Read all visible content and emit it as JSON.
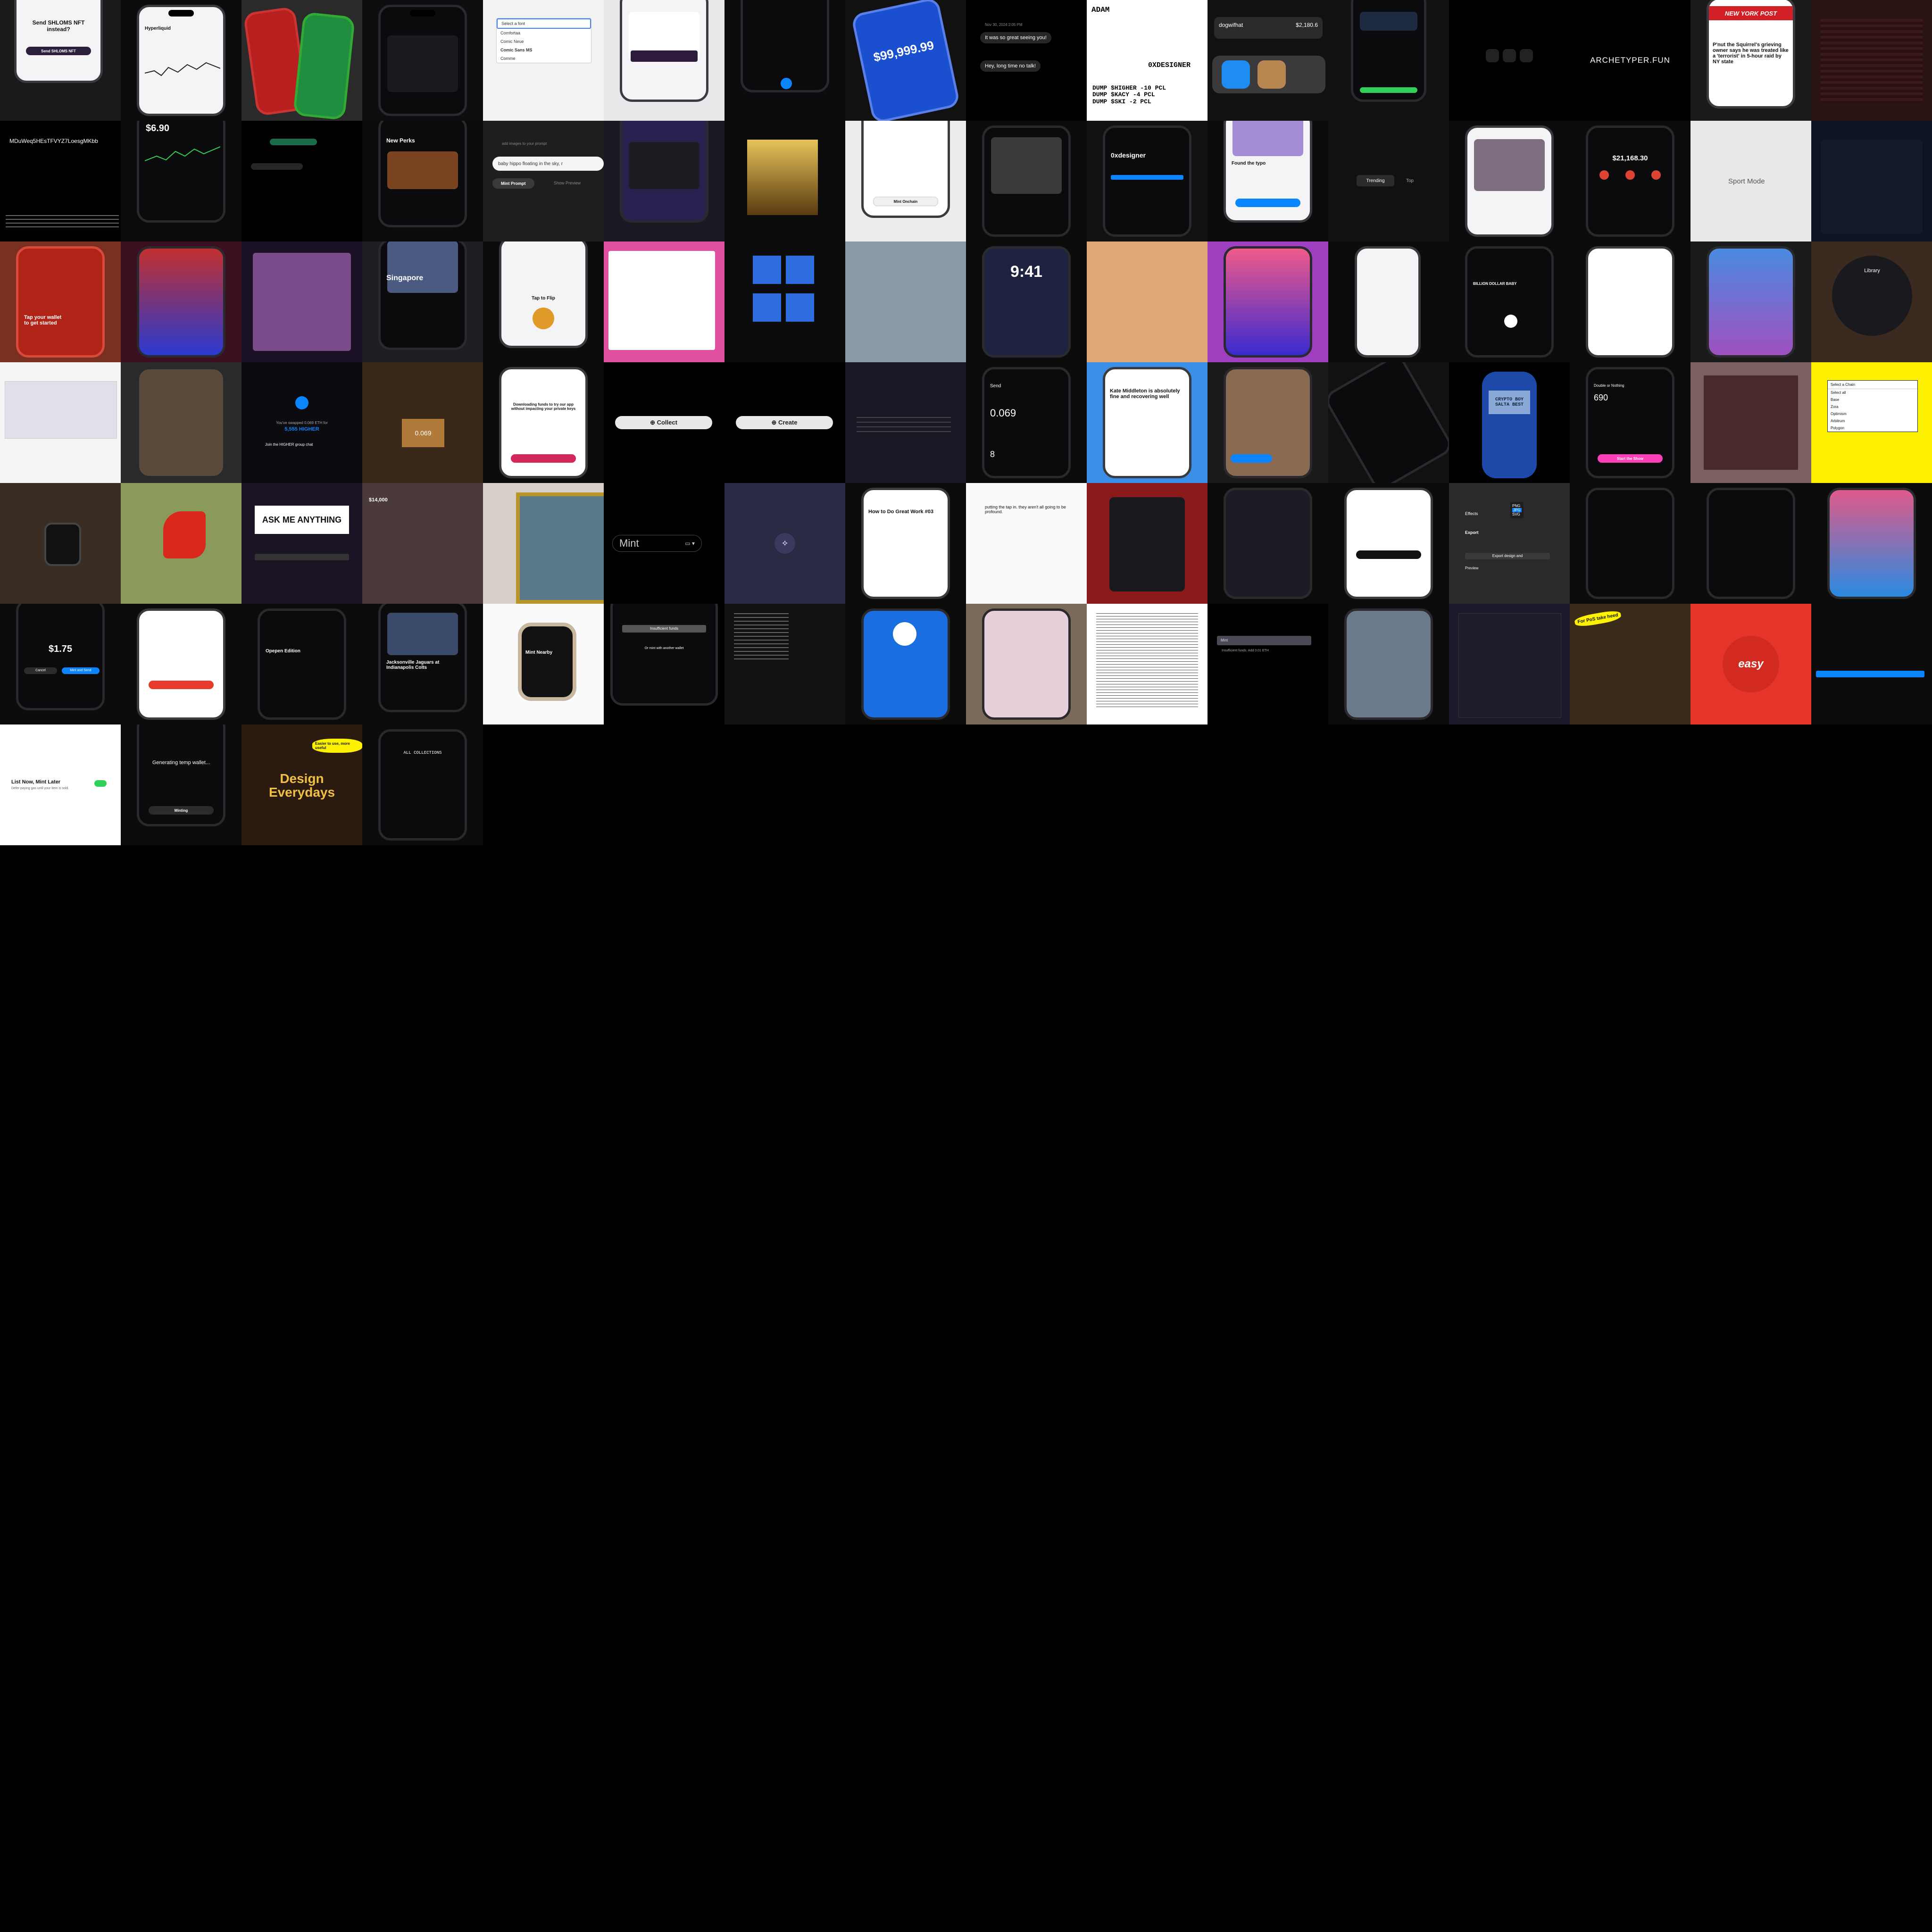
{
  "tiles": {
    "r0": {
      "send": {
        "title": "Send SHLOMS NFT instead?",
        "button": "Send SHLOMS NFT"
      },
      "hyperliquid": {
        "title": "Hyperliquid"
      },
      "font_menu": {
        "items": [
          "Select a font",
          "Comfortaa",
          "Comic Neue",
          "Comic Sans MS",
          "Comme"
        ]
      },
      "bitcoin_price": {
        "price": "$99,999.99"
      },
      "chat": {
        "date": "Nov 30, 2024 2:05 PM",
        "msg1": "It was so great seeing you!",
        "msg2": "Hey, long time no talk!"
      },
      "oxdesigner": {
        "name": "ADAM",
        "handle": "0XDESIGNER",
        "rows": [
          "DUMP $HIGHER -10 PCL",
          "DUMP $KACY -4 PCL",
          "DUMP $SKI -2 PCL"
        ]
      },
      "dogwifhat": {
        "label": "dogwifhat",
        "price": "$2,180.6"
      },
      "archetyper": {
        "label": "ARCHETYPER.FUN"
      },
      "nypost": {
        "brand": "NEW YORK POST",
        "headline": "P'nut the Squirrel's grieving owner says he was treated like a 'terrorist' in 5-hour raid by NY state"
      }
    },
    "r1": {
      "search": {
        "query": "MDuWeq5HEsTFVYZ7LoesgMKbb"
      },
      "price": {
        "value": "$6.90"
      },
      "perks": {
        "title": "New Perks"
      },
      "prompt": {
        "placeholder": "add images to your prompt",
        "value": "baby hippo floating in the sky, r",
        "button": "Mint Prompt",
        "link": "Show Preview"
      },
      "mint_onchain": {
        "button": "Mint Onchain"
      },
      "oxdesigner_phone": {
        "title": "0xdesigner"
      },
      "found": {
        "title": "Found the typo"
      },
      "tabs": {
        "trending": "Trending",
        "top": "Top"
      },
      "balance": {
        "value": "$21,168.30"
      },
      "sport": {
        "label": "Sport Mode"
      }
    },
    "r2": {
      "wallet": {
        "text": "Tap your wallet to get started"
      },
      "singapore": {
        "title": "Singapore"
      },
      "flip": {
        "title": "Tap to Flip"
      },
      "lock": {
        "time": "9:41"
      },
      "billion": {
        "title": "BILLION DOLLAR BABY"
      },
      "library": {
        "title": "Library"
      }
    },
    "r3": {
      "swapped": {
        "title": "You've swapped 0.069 ETH for",
        "amount": "5,555 HIGHER",
        "link": "Join the HIGHER group chat"
      },
      "box": {
        "label": "0.069"
      },
      "survey": {
        "title": "Downloading funds to try our app without impacting your private keys"
      },
      "collect": {
        "label": "Collect"
      },
      "create": {
        "label": "Create"
      },
      "send": {
        "title": "Send",
        "amount": "0.069",
        "fee": "8"
      },
      "kate": {
        "headline": "Kate Middleton is absolutely fine and recovering well"
      },
      "nokia": {
        "text": "CRYPTO BOY SALTA BEST"
      },
      "double": {
        "title": "Double or Nothing",
        "value": "690",
        "button": "Start the Show"
      },
      "chain": {
        "title": "Select a Chain",
        "items": [
          "Select all",
          "Base",
          "Zora",
          "Optimism",
          "Arbitrum",
          "Polygon"
        ]
      }
    },
    "r4": {
      "ama": {
        "title": "ASK ME ANYTHING"
      },
      "blur": {
        "value": "$14,000"
      },
      "mint": {
        "label": "Mint"
      },
      "article": {
        "title": "How to Do Great Work #03"
      },
      "typing": {
        "text": "putting the tap in. they aren't all going to be profound."
      },
      "export": {
        "title": "Export",
        "effects": "Effects",
        "button": "Export design and",
        "preview": "Preview",
        "options": [
          "PNG",
          "JPG",
          "SVG"
        ]
      }
    },
    "r5": {
      "pay": {
        "amount": "$1.75",
        "cancel": "Cancel",
        "confirm": "Mint and Send"
      },
      "opepen": {
        "title": "Opepen Edition"
      },
      "jaguars": {
        "title": "Jacksonville Jaguars at Indianapolis Colts"
      },
      "watch": {
        "title": "Mint Nearby"
      },
      "insufficient": {
        "label": "Insufficient funds",
        "link": "Or mint with another wallet"
      },
      "low": {
        "input": "Mint",
        "note": "Insufficient funds. Add 0.01 ETH"
      },
      "easy": {
        "label": "easy"
      },
      "vitalik": {
        "bubble": "For PoS take heed"
      }
    },
    "r6": {
      "list": {
        "title": "List Now, Mint Later",
        "sub": "Defer paying gas until your item is sold."
      },
      "temp": {
        "title": "Generating temp wallet...",
        "button": "Minting"
      },
      "everydays": {
        "title": "Design Everydays",
        "bubble": "Easier to use, more useful"
      },
      "collections": {
        "title": "ALL COLLECTIONS"
      }
    }
  },
  "colors": {
    "accent_green": "#30d158",
    "accent_blue": "#0a84ff",
    "accent_purple": "#bf5af2",
    "nypost_red": "#d21f26",
    "easy_red": "#e53429",
    "chain_yellow": "#fff200"
  }
}
